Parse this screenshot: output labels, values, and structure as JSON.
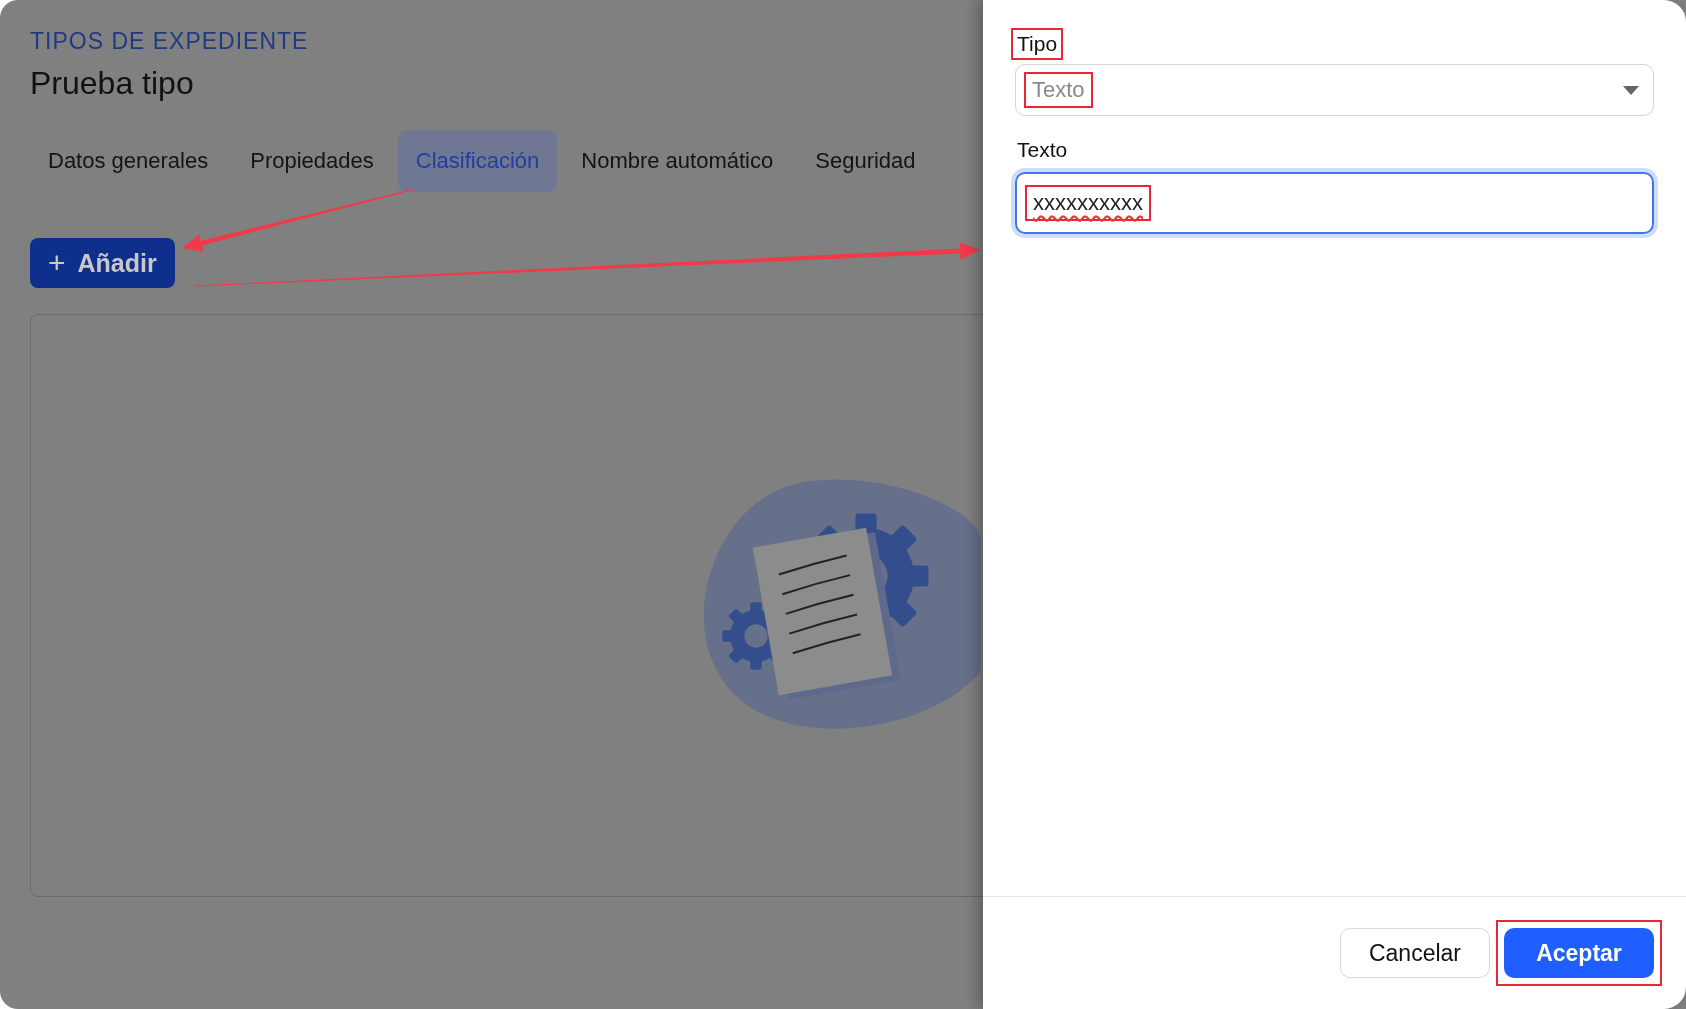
{
  "page": {
    "section_title": "TIPOS DE EXPEDIENTE",
    "title": "Prueba tipo",
    "tabs": [
      {
        "label": "Datos generales",
        "selected": false
      },
      {
        "label": "Propiedades",
        "selected": false
      },
      {
        "label": "Clasificación",
        "selected": true
      },
      {
        "label": "Nombre automático",
        "selected": false
      },
      {
        "label": "Seguridad",
        "selected": false
      }
    ],
    "add_button": {
      "icon": "+",
      "label": "Añadir"
    }
  },
  "dialog": {
    "fields": [
      {
        "kind": "select",
        "label": "Tipo",
        "label_highlighted": true,
        "value": "Texto",
        "value_highlighted": true,
        "focused": false,
        "spellcheck_error": false
      },
      {
        "kind": "text",
        "label": "Texto",
        "label_highlighted": false,
        "value": "xxxxxxxxxx",
        "value_highlighted": true,
        "focused": true,
        "spellcheck_error": true
      }
    ],
    "buttons": [
      {
        "label": "Cancelar",
        "kind": "secondary",
        "highlighted": false
      },
      {
        "label": "Aceptar",
        "kind": "primary",
        "highlighted": true
      }
    ]
  }
}
